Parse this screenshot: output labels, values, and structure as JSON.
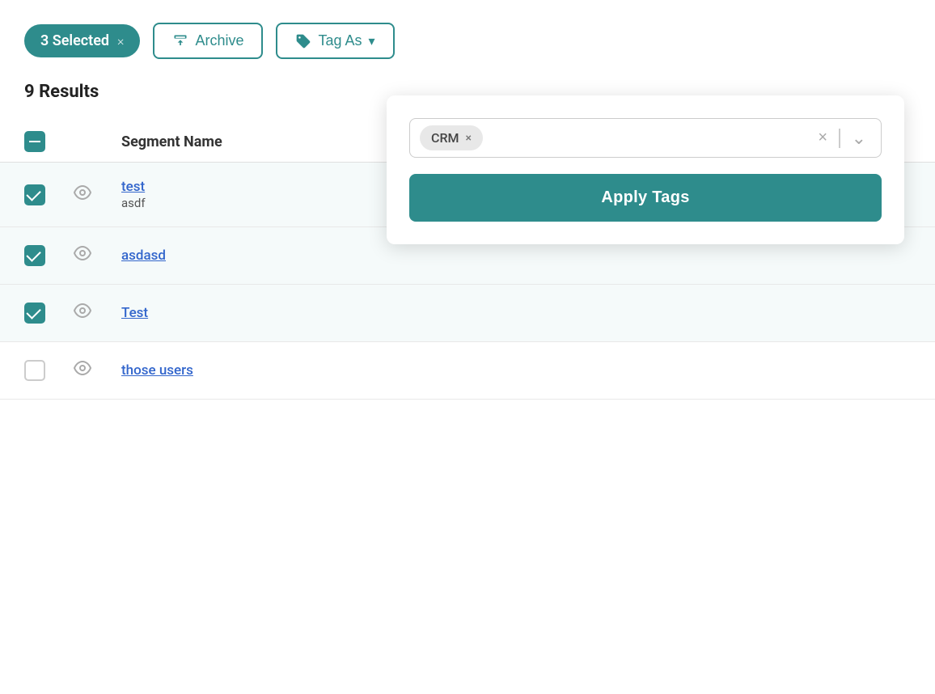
{
  "toolbar": {
    "selected_label": "3 Selected",
    "selected_close": "×",
    "archive_label": "Archive",
    "tag_as_label": "Tag As"
  },
  "results": {
    "count_label": "9 Results"
  },
  "table": {
    "column_name": "Segment Name",
    "rows": [
      {
        "id": "row-test",
        "checked": true,
        "name": "test",
        "sub": "asdf",
        "has_sub": true
      },
      {
        "id": "row-asdasd",
        "checked": true,
        "name": "asdasd",
        "sub": "",
        "has_sub": false
      },
      {
        "id": "row-Test",
        "checked": true,
        "name": "Test",
        "sub": "",
        "has_sub": false
      },
      {
        "id": "row-those-users",
        "checked": false,
        "name": "those users",
        "sub": "",
        "has_sub": false
      }
    ]
  },
  "tag_dropdown": {
    "tag_chip_label": "CRM",
    "tag_chip_close": "×",
    "clear_label": "×",
    "chevron_label": "⌄",
    "apply_button_label": "Apply Tags"
  },
  "icons": {
    "archive": "archive-icon",
    "tag": "tag-icon",
    "eye": "👁",
    "chevron_down": "⌄"
  }
}
